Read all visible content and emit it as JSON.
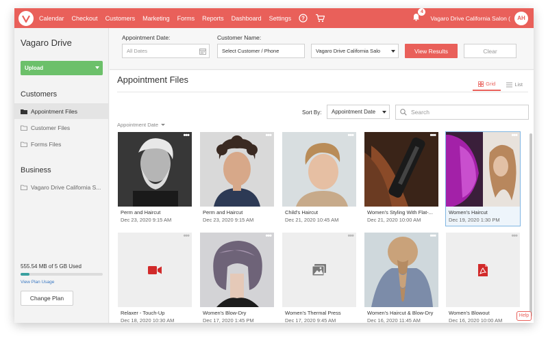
{
  "nav": {
    "links": [
      "Calendar",
      "Checkout",
      "Customers",
      "Marketing",
      "Forms",
      "Reports",
      "Dashboard",
      "Settings"
    ],
    "notification_count": "4",
    "salon_name": "Vagaro Drive California Salon (",
    "user_initials": "AH",
    "icons": [
      "vagaro-logo-icon",
      "help-icon",
      "cart-icon",
      "bell-icon"
    ],
    "accent_color": "#e9605a"
  },
  "sidebar": {
    "title": "Vagaro Drive",
    "upload_label": "Upload",
    "customers_heading": "Customers",
    "customer_items": [
      "Appointment Files",
      "Customer Files",
      "Forms Files"
    ],
    "business_heading": "Business",
    "business_items": [
      "Vagaro Drive California S..."
    ],
    "storage_text": "555.54 MB of 5 GB Used",
    "storage_fraction": 0.11,
    "view_usage": "View Plan Usage",
    "change_plan": "Change Plan"
  },
  "filters": {
    "date_label": "Appointment Date:",
    "date_placeholder": "All Dates",
    "customer_label": "Customer Name:",
    "customer_value": "Select Customer / Phone",
    "location_value": "Vagaro Drive California Salo",
    "view_results": "View Results",
    "clear": "Clear"
  },
  "main": {
    "title": "Appointment Files",
    "tab_grid": "Grid",
    "tab_list": "List",
    "sort_label": "Sort By:",
    "sort_value": "Appointment Date",
    "search_placeholder": "Search",
    "group_label": "Appointment Date",
    "help": "Help"
  },
  "files": [
    {
      "name": "Perm and Haircut",
      "date": "Dec 23, 2020 9:15 AM",
      "thumb": "photo"
    },
    {
      "name": "Perm and Haircut",
      "date": "Dec 23, 2020 9:15 AM",
      "thumb": "photo"
    },
    {
      "name": "Child's Haircut",
      "date": "Dec 21, 2020 10:45 AM",
      "thumb": "photo"
    },
    {
      "name": "Women's Styling With Flat-...",
      "date": "Dec 21, 2020 10:00 AM",
      "thumb": "photo"
    },
    {
      "name": "Women's Haircut",
      "date": "Dec 19, 2020 1:30 PM",
      "thumb": "photo",
      "selected": true
    },
    {
      "name": "Relaxer - Touch-Up",
      "date": "Dec 18, 2020 10:30 AM",
      "thumb": "video-icon"
    },
    {
      "name": "Women's Blow-Dry",
      "date": "Dec 17, 2020 1:45 PM",
      "thumb": "photo"
    },
    {
      "name": "Women's Thermal Press",
      "date": "Dec 17, 2020 9:45 AM",
      "thumb": "image-icon"
    },
    {
      "name": "Women's Haircut & Blow-Dry",
      "date": "Dec 16, 2020 11:45 AM",
      "thumb": "photo"
    },
    {
      "name": "Women's Blowout",
      "date": "Dec 16, 2020 10:00 AM",
      "thumb": "pdf-icon"
    }
  ]
}
